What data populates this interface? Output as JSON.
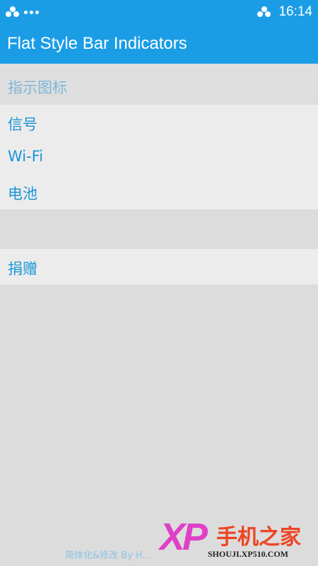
{
  "status_bar": {
    "time": "16:14",
    "left_icons": [
      "cluster-icon",
      "dots-icon"
    ],
    "right_icons": [
      "cluster-icon"
    ]
  },
  "app_bar": {
    "title": "Flat Style Bar Indicators"
  },
  "category": {
    "label": "指示图标"
  },
  "items": [
    {
      "label": "信号"
    },
    {
      "label": "Wi-Fi"
    },
    {
      "label": "电池"
    }
  ],
  "donate": {
    "label": "捐赠"
  },
  "footer": {
    "credit": "简体化&修改 By H..."
  },
  "watermark": {
    "brand": "手机之家",
    "url": "SHOUJI.XP510.COM",
    "logo_text": "XP"
  },
  "colors": {
    "primary": "#1b9de6",
    "item_text": "#1a96d8",
    "category_text": "#7fb6d8",
    "background": "#dcdcdc",
    "group_background": "#ececec"
  }
}
